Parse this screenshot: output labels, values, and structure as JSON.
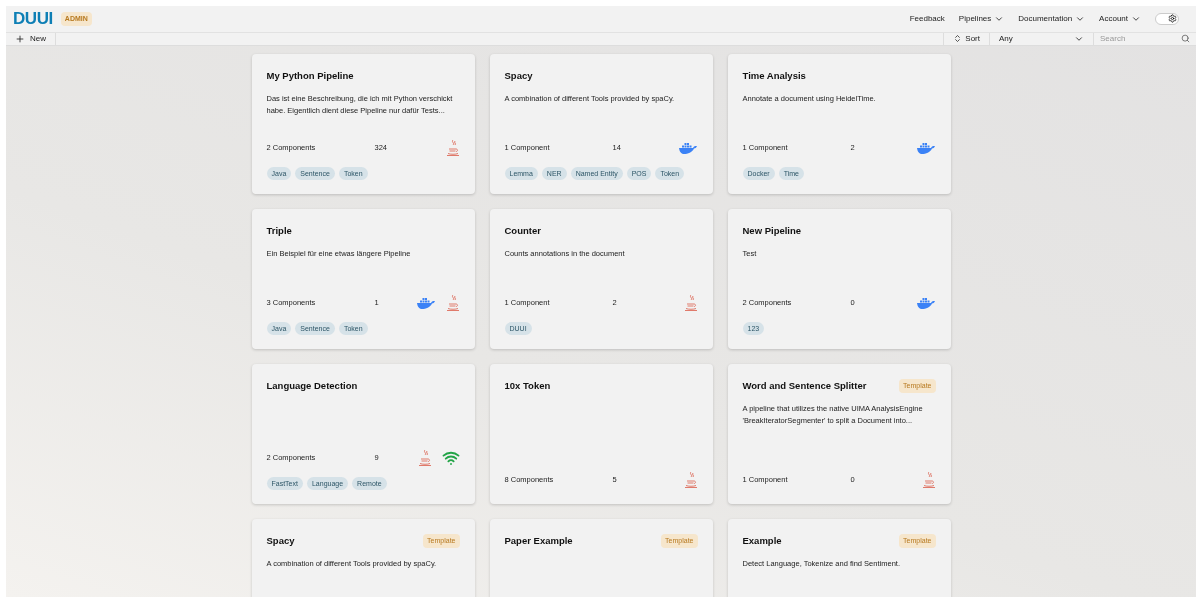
{
  "header": {
    "logo": "DUUI",
    "role_badge": "ADMIN",
    "theme_toggle": {
      "on": true
    },
    "nav": [
      {
        "label": "Feedback",
        "dropdown": false
      },
      {
        "label": "Pipelines",
        "dropdown": true
      },
      {
        "label": "Documentation",
        "dropdown": true
      },
      {
        "label": "Account",
        "dropdown": true
      }
    ]
  },
  "toolbar": {
    "new_button": "New",
    "sort_button": "Sort",
    "filter_select": "Any",
    "search": {
      "placeholder": "Search"
    }
  },
  "pipelines": [
    {
      "title": "My Python Pipeline",
      "description": "Das ist eine Beschreibung, die ich mit Python verschickt habe. Eigentlich dient diese Pipeline nur dafür Tests...",
      "components": "2 Components",
      "count": "324",
      "icons": [
        {
          "kind": "java"
        }
      ],
      "tags": [
        "Java",
        "Sentence",
        "Token"
      ]
    },
    {
      "title": "Spacy",
      "description": "A combination of different Tools provided by spaCy.",
      "components": "1 Component",
      "count": "14",
      "icons": [
        {
          "kind": "docker"
        }
      ],
      "tags": [
        "Lemma",
        "NER",
        "Named Entity",
        "POS",
        "Token"
      ]
    },
    {
      "title": "Time Analysis",
      "description": "Annotate a document using HeidelTime.",
      "components": "1 Component",
      "count": "2",
      "icons": [
        {
          "kind": "docker"
        }
      ],
      "tags": [
        "Docker",
        "Time"
      ]
    },
    {
      "title": "Triple",
      "description": "Ein Beispiel für eine etwas längere Pipeline",
      "components": "3 Components",
      "count": "1",
      "icons": [
        {
          "kind": "docker"
        },
        {
          "kind": "java"
        }
      ],
      "tags": [
        "Java",
        "Sentence",
        "Token"
      ]
    },
    {
      "title": "Counter",
      "description": "Counts annotations in the document",
      "components": "1 Component",
      "count": "2",
      "icons": [
        {
          "kind": "java"
        }
      ],
      "tags": [
        "DUUI"
      ]
    },
    {
      "title": "New Pipeline",
      "description": "Test",
      "components": "2 Components",
      "count": "0",
      "icons": [
        {
          "kind": "docker"
        }
      ],
      "tags": [
        "123"
      ]
    },
    {
      "title": "Language Detection",
      "components": "2 Components",
      "count": "9",
      "icons": [
        {
          "kind": "java"
        },
        {
          "kind": "remote"
        }
      ],
      "tags": [
        "FastText",
        "Language",
        "Remote"
      ]
    },
    {
      "title": "10x Token",
      "components": "8 Components",
      "count": "5",
      "icons": [
        {
          "kind": "java"
        }
      ]
    },
    {
      "title": "Word and Sentence Splitter",
      "badge": "Template",
      "description": "A pipeline that utilizes the native UIMA AnalysisEngine 'BreakIteratorSegmenter' to split a Document into...",
      "components": "1 Component",
      "count": "0",
      "icons": [
        {
          "kind": "java"
        }
      ]
    },
    {
      "title": "Spacy",
      "badge": "Template",
      "description": "A combination of different Tools provided by spaCy."
    },
    {
      "title": "Paper Example",
      "badge": "Template"
    },
    {
      "title": "Example",
      "badge": "Template",
      "description": "Detect Language, Tokenize and find Sentiment."
    }
  ]
}
